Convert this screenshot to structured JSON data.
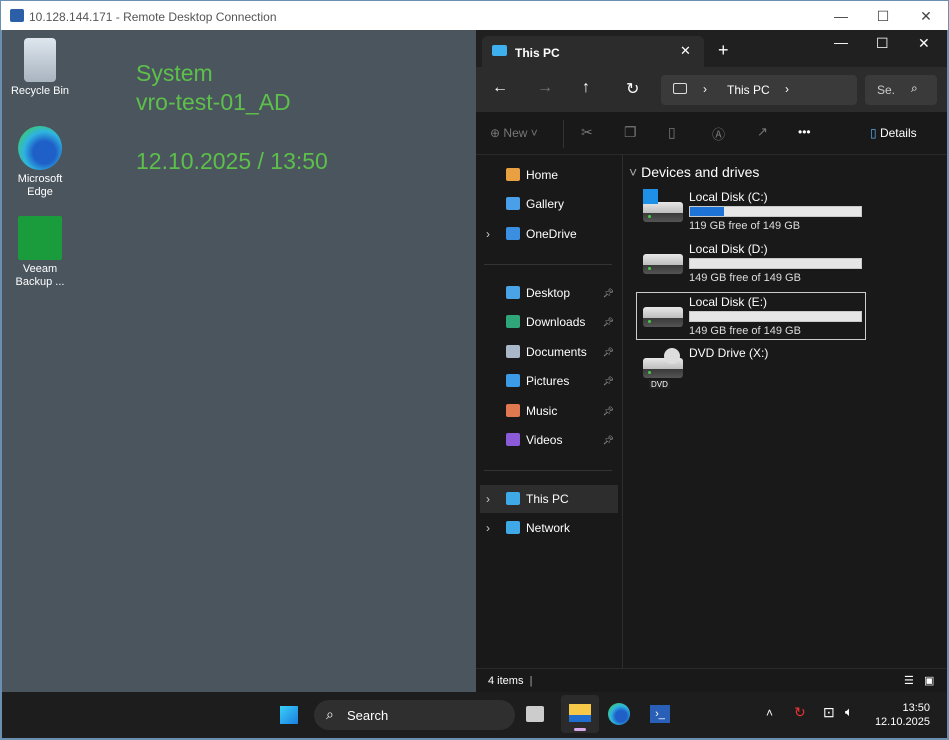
{
  "window": {
    "title": "10.128.144.171 - Remote Desktop Connection"
  },
  "desktop": {
    "icons": [
      {
        "label": "Recycle Bin"
      },
      {
        "label": "Microsoft Edge"
      },
      {
        "label": "Veeam Backup ..."
      }
    ],
    "info": {
      "line1": "System",
      "line2": "vro-test-01_AD",
      "line3": "12.10.2025 / 13:50"
    }
  },
  "explorer": {
    "tab_title": "This PC",
    "address": {
      "crumb": "This PC",
      "search_placeholder": "Se."
    },
    "toolbar": {
      "new_label": "New",
      "details_label": "Details",
      "more": "•••"
    },
    "sidebar": [
      {
        "label": "Home",
        "color": "#e8a040"
      },
      {
        "label": "Gallery",
        "color": "#4aa0e8"
      },
      {
        "label": "OneDrive",
        "color": "#3b8fe0"
      },
      {
        "label": "Desktop",
        "color": "#4aa3e6"
      },
      {
        "label": "Downloads",
        "color": "#2fa57a"
      },
      {
        "label": "Documents",
        "color": "#a8b8c8"
      },
      {
        "label": "Pictures",
        "color": "#3c9be6"
      },
      {
        "label": "Music",
        "color": "#e07850"
      },
      {
        "label": "Videos",
        "color": "#8a5ad8"
      },
      {
        "label": "This PC",
        "color": "#3fa9e8"
      },
      {
        "label": "Network",
        "color": "#3fa9e8"
      }
    ],
    "section_title": "Devices and drives",
    "drives": [
      {
        "name": "Local Disk (C:)",
        "free": "119 GB free of 149 GB",
        "used_fraction": 0.2
      },
      {
        "name": "Local Disk (D:)",
        "free": "149 GB free of 149 GB",
        "used_fraction": 0
      },
      {
        "name": "Local Disk (E:)",
        "free": "149 GB free of 149 GB",
        "used_fraction": 0
      },
      {
        "name": "DVD Drive (X:)",
        "dvd_label": "DVD"
      }
    ],
    "status": "4 items"
  },
  "taskbar": {
    "search": "Search",
    "time": "13:50",
    "date": "12.10.2025"
  }
}
